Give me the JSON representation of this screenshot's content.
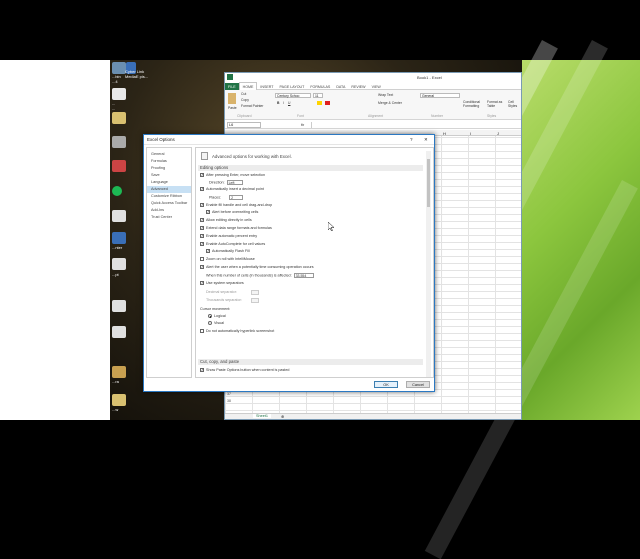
{
  "desktop_labels": [
    {
      "text": "...bin\n...4"
    },
    {
      "text": "Cyber Link\nMediaE pis..."
    },
    {
      "text": "...\n..."
    },
    {
      "text": "...s"
    },
    {
      "text": "...nter"
    },
    {
      "text": "...pt"
    },
    {
      "text": "...ra"
    },
    {
      "text": "...w"
    },
    {
      "text": "...s"
    }
  ],
  "excel": {
    "title": "Book1 - Excel",
    "tabs": [
      "FILE",
      "HOME",
      "INSERT",
      "PAGE LAYOUT",
      "FORMULAS",
      "DATA",
      "REVIEW",
      "VIEW"
    ],
    "ribbon": {
      "cut": "Cut",
      "copy": "Copy",
      "format_painter": "Format Painter",
      "paste": "Paste",
      "clipboard": "Clipboard",
      "font_name": "Century Schoo",
      "font_size": "11",
      "font": "Font",
      "wrap": "Wrap Text",
      "merge": "Merge & Center",
      "alignment": "Alignment",
      "number_format": "General",
      "number": "Number",
      "conditional": "Conditional\nFormatting",
      "format_table": "Format as\nTable",
      "cell_styles": "Cell\nStyles",
      "styles": "Styles"
    },
    "name_box": "L6",
    "fx": "fx",
    "col_headers": [
      "H",
      "I",
      "J"
    ],
    "row_numbers": [
      "37",
      "38"
    ],
    "sheet_tab": "Sheet1"
  },
  "dialog": {
    "title": "Excel Options",
    "help": "?",
    "close": "✕",
    "nav": [
      "General",
      "Formulas",
      "Proofing",
      "Save",
      "Language",
      "Advanced",
      "Customize Ribbon",
      "Quick Access Toolbar",
      "Add-Ins",
      "Trust Center"
    ],
    "nav_selected": 5,
    "header": "Advanced options for working with Excel.",
    "section1": "Editing options",
    "opt_after_enter": "After pressing Enter, move selection",
    "direction_label": "Direction:",
    "direction_value": "Left",
    "opt_decimal": "Automatically insert a decimal point",
    "places_label": "Places:",
    "places_value": "2",
    "opt_fill": "Enable fill handle and cell drag-and-drop",
    "opt_alert": "Alert before overwriting cells",
    "opt_edit_directly": "Allow editing directly in cells",
    "opt_extend": "Extend data range formats and formulas",
    "opt_percent": "Enable automatic percent entry",
    "opt_autocomplete": "Enable AutoComplete for cell values",
    "opt_flash": "Automatically Flash Fill",
    "opt_zoom": "Zoom on roll with IntelliMouse",
    "opt_alert_user": "Alert the user when a potentially time consuming operation occurs",
    "cells_label": "When this number of cells (in thousands) is affected:",
    "cells_value": "33,554",
    "opt_separators": "Use system separators",
    "decimal_sep": "Decimal separator:",
    "thousands_sep": "Thousands separator:",
    "cursor_movement": "Cursor movement:",
    "logical": "Logical",
    "visual": "Visual",
    "opt_hyperlink": "Do not automatically hyperlink screenshot",
    "section2": "Cut, copy, and paste",
    "opt_paste": "Show Paste Options button when content is pasted",
    "ok": "OK",
    "cancel": "Cancel"
  },
  "colors": {
    "excel_green": "#217346",
    "accent_blue": "#2b78c2",
    "nav_selected": "#c7e0f4",
    "desktop_green": "#8cc63e"
  }
}
